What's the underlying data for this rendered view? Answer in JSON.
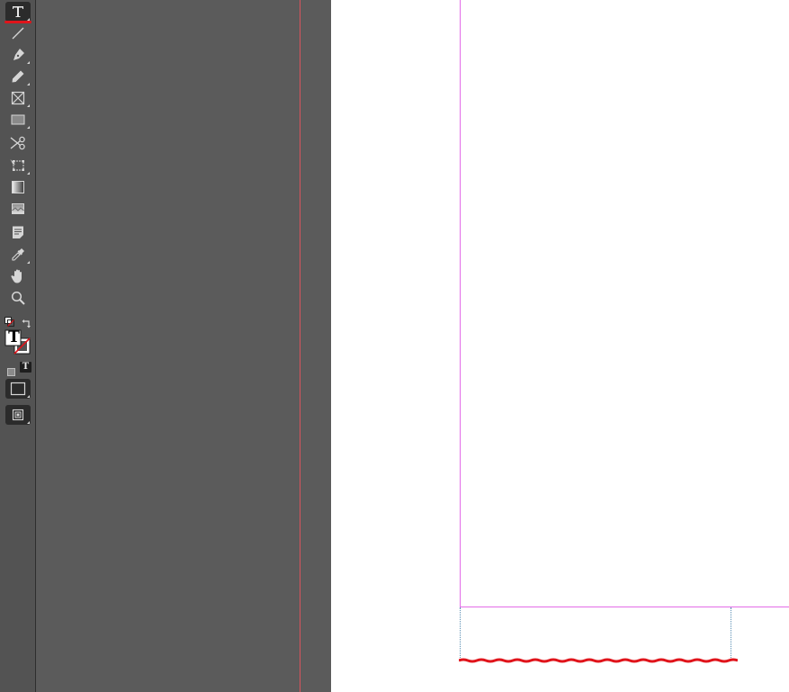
{
  "toolbox": {
    "tools": [
      {
        "name": "type-tool",
        "icon": "type-icon",
        "active": true,
        "has_flyout": true
      },
      {
        "name": "line-tool",
        "icon": "line-icon"
      },
      {
        "name": "pen-tool",
        "icon": "pen-icon",
        "has_flyout": true
      },
      {
        "name": "pencil-tool",
        "icon": "pencil-icon",
        "has_flyout": true
      },
      {
        "name": "rectangle-frame-tool",
        "icon": "rectangle-frame-icon",
        "has_flyout": true
      },
      {
        "name": "rectangle-tool",
        "icon": "rectangle-icon",
        "has_flyout": true
      },
      {
        "name": "scissors-tool",
        "icon": "scissors-icon"
      },
      {
        "name": "free-transform-tool",
        "icon": "free-transform-icon",
        "has_flyout": true
      },
      {
        "name": "gradient-swatch-tool",
        "icon": "gradient-swatch-icon"
      },
      {
        "name": "gradient-feather-tool",
        "icon": "gradient-feather-icon"
      },
      {
        "name": "note-tool",
        "icon": "note-icon"
      },
      {
        "name": "eyedropper-tool",
        "icon": "eyedropper-icon",
        "has_flyout": true
      },
      {
        "name": "hand-tool",
        "icon": "hand-icon"
      },
      {
        "name": "zoom-tool",
        "icon": "zoom-icon"
      }
    ],
    "fill_stroke": {
      "fill_glyph": "T",
      "default_colors_icon": "default-fill-stroke-icon",
      "swap_icon": "swap-fill-stroke-icon"
    },
    "formatting": {
      "container_icon": "formatting-affects-container-icon",
      "text_glyph": "T"
    },
    "view_mode_icon": "normal-view-mode-icon",
    "screen_mode_icon": "screen-mode-icon"
  },
  "colors": {
    "toolbox_bg": "#535353",
    "pasteboard_bg": "#5b5b5b",
    "page_bg": "#ffffff",
    "margin_guide": "#e36ce8",
    "bleed_guide": "#d9535c",
    "frame_edge": "#5a8fb4",
    "spell_error": "#e0141b",
    "active_tool_bg": "#2b2b2b"
  }
}
